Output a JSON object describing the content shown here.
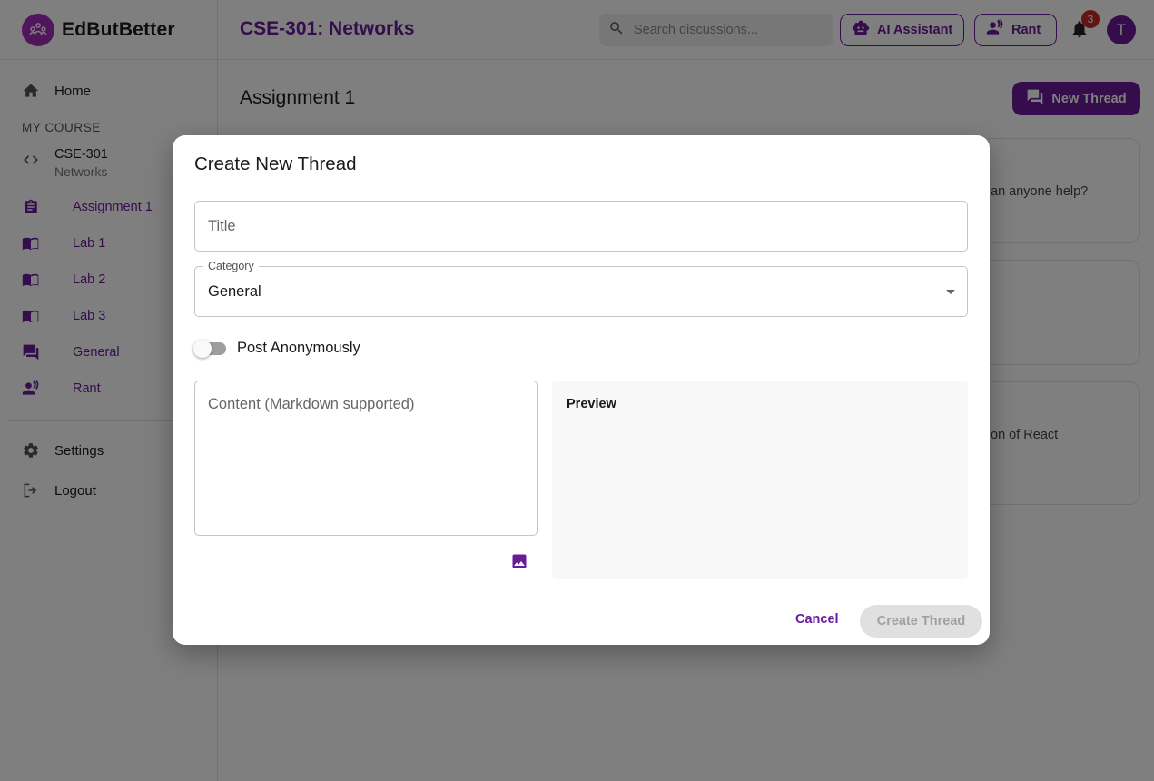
{
  "app": {
    "name": "EdButBetter"
  },
  "sidebar": {
    "home_label": "Home",
    "section_label": "MY COURSE",
    "course": {
      "code": "CSE-301",
      "name": "Networks"
    },
    "items": [
      {
        "label": "Assignment 1",
        "icon": "assignment-icon"
      },
      {
        "label": "Lab 1",
        "icon": "book-icon"
      },
      {
        "label": "Lab 2",
        "icon": "book-icon"
      },
      {
        "label": "Lab 3",
        "icon": "book-icon"
      },
      {
        "label": "General",
        "icon": "forum-icon"
      },
      {
        "label": "Rant",
        "icon": "speaker-person-icon"
      }
    ],
    "settings_label": "Settings",
    "logout_label": "Logout"
  },
  "header": {
    "course_title": "CSE-301: Networks",
    "search_placeholder": "Search discussions...",
    "ai_label": "AI Assistant",
    "rant_label": "Rant",
    "notification_count": "3",
    "avatar_initial": "T"
  },
  "main": {
    "title": "Assignment 1",
    "new_thread_label": "New Thread",
    "snippets": [
      "an anyone help?",
      "",
      "on of React"
    ]
  },
  "modal": {
    "title": "Create New Thread",
    "title_placeholder": "Title",
    "category_label": "Category",
    "category_value": "General",
    "anonymous_label": "Post Anonymously",
    "anonymous_on": false,
    "content_placeholder": "Content (Markdown supported)",
    "preview_label": "Preview",
    "cancel_label": "Cancel",
    "create_label": "Create Thread"
  },
  "colors": {
    "accent": "#6a1b9a",
    "logo": "#a02bb7",
    "badge": "#c62828",
    "disabled_bg": "#e0e0e0"
  }
}
